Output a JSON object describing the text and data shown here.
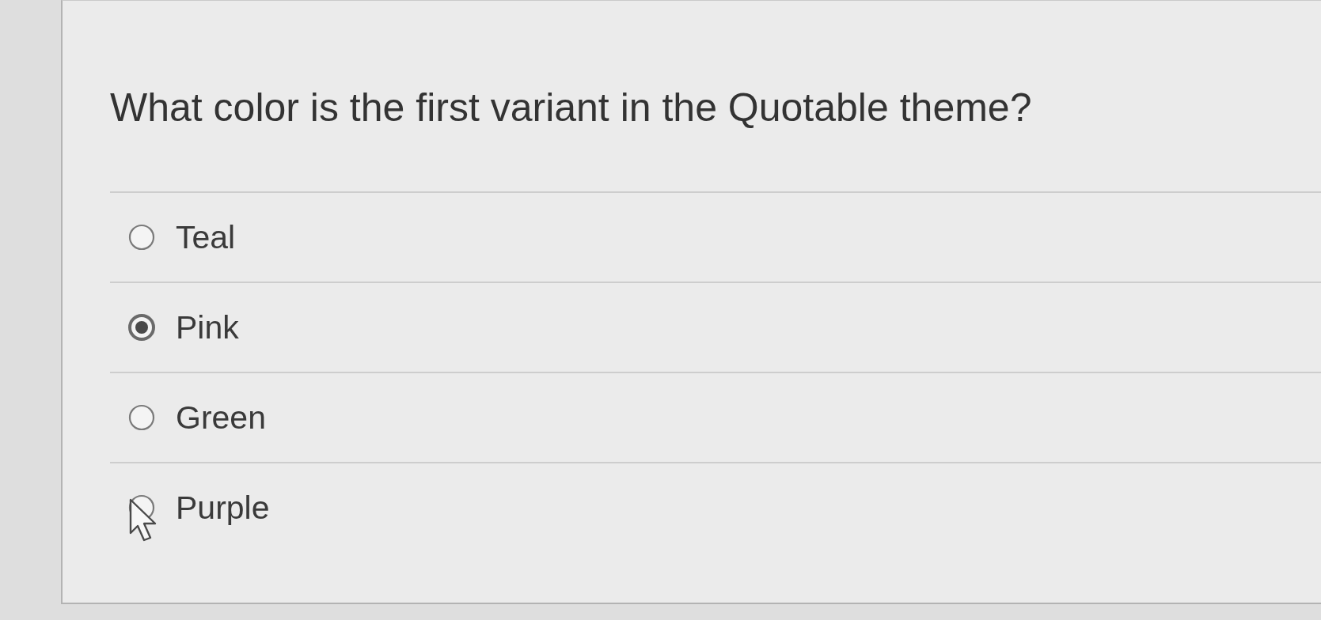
{
  "question": {
    "text": "What color is the first variant in the Quotable theme?"
  },
  "options": [
    {
      "label": "Teal",
      "selected": false
    },
    {
      "label": "Pink",
      "selected": true
    },
    {
      "label": "Green",
      "selected": false
    },
    {
      "label": "Purple",
      "selected": false
    }
  ]
}
